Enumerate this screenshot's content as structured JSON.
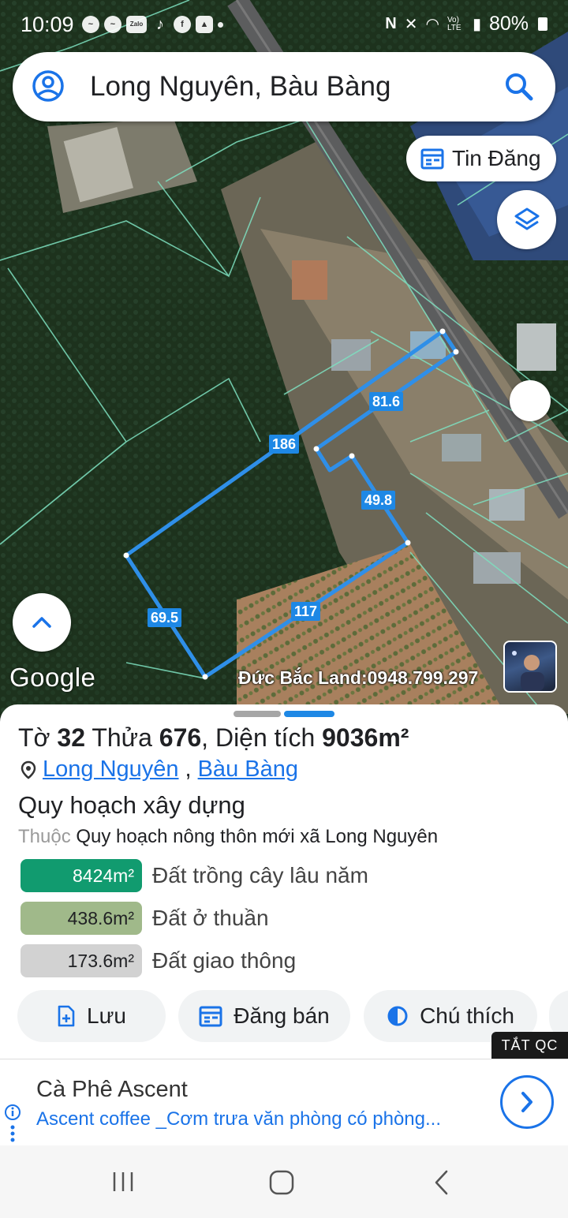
{
  "status_bar": {
    "time": "10:09",
    "battery": "80%",
    "app_icons": [
      "messenger-icon",
      "messenger-icon",
      "zalo-icon",
      "tiktok-icon",
      "facebook-icon",
      "gallery-icon"
    ],
    "zalo_label": "Zalo",
    "system_icons": [
      "nfc-icon",
      "mute-icon",
      "wifi-icon",
      "volte-icon",
      "signal-icon",
      "battery-icon"
    ],
    "volte_label": "Vo) LTE"
  },
  "search": {
    "query": "Long Nguyên, Bàu Bàng"
  },
  "map": {
    "tin_dang_label": "Tin Đăng",
    "google_logo": "Google",
    "watermark": "Đức Bắc Land:0948.799.297",
    "edge_labels": {
      "north_east": "81.6",
      "north_west": "186",
      "east": "49.8",
      "south_west": "69.5",
      "south": "117"
    },
    "boundary_color": "#2f8fe8"
  },
  "parcel": {
    "to_label": "Tờ",
    "to_number": "32",
    "thua_label": "Thửa",
    "thua_number": "676",
    "dien_tich_label": ", Diện tích",
    "area_value": "9036m²",
    "location_parts": [
      "Long Nguyên",
      "Bàu Bàng"
    ],
    "location_sep": ",",
    "planning_title": "Quy hoạch xây dựng",
    "thuoc_prefix": "Thuộc",
    "thuoc_value": "Quy hoạch nông thôn mới xã Long Nguyên"
  },
  "land_uses": [
    {
      "area": "8424m²",
      "name": "Đất trồng cây lâu năm",
      "color": "#119b6f"
    },
    {
      "area": "438.6m²",
      "name": "Đất ở thuần",
      "color": "#a0b98a"
    },
    {
      "area": "173.6m²",
      "name": "Đất giao thông",
      "color": "#d2d2d2"
    }
  ],
  "actions": {
    "save_label": "Lưu",
    "sell_label": "Đăng bán",
    "legend_label": "Chú thích"
  },
  "ad": {
    "close_label": "TẮT QC",
    "headline": "Cà Phê Ascent",
    "subline": "Ascent coffee _Cơm trưa văn phòng có phòng..."
  },
  "nav": {
    "items": [
      "recents-icon",
      "home-icon",
      "back-icon"
    ]
  }
}
